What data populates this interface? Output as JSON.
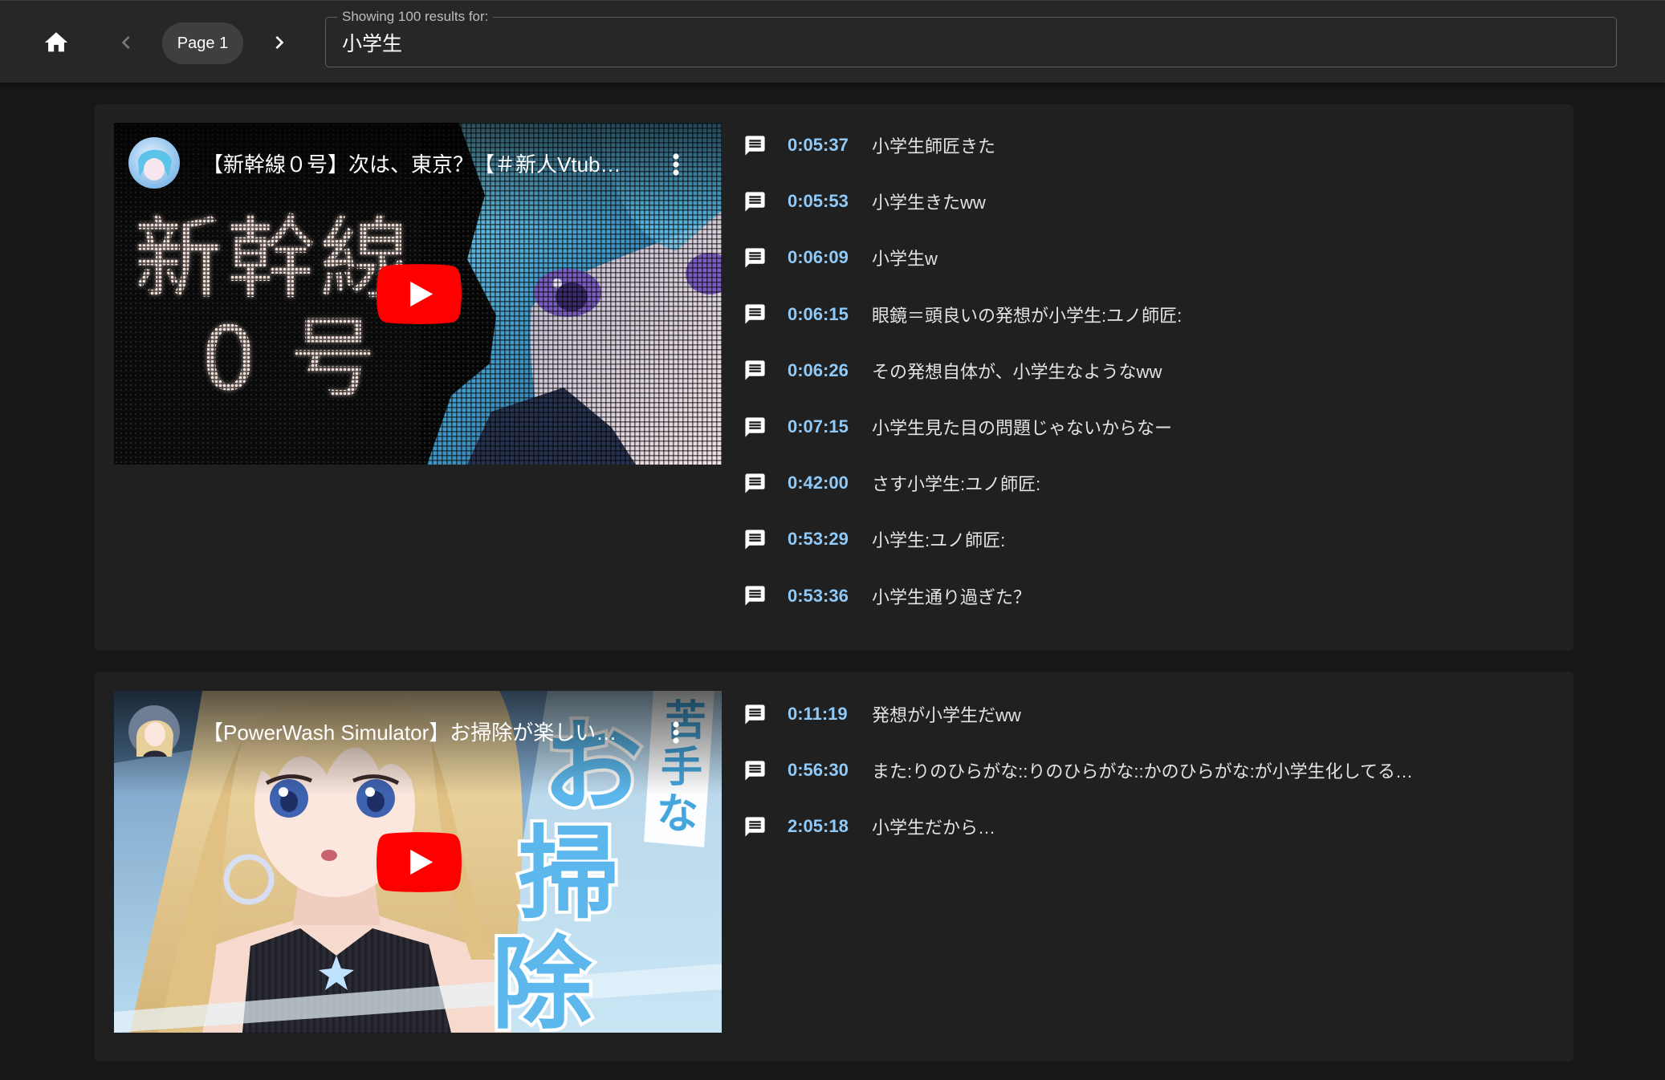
{
  "header": {
    "home_icon": "home-icon",
    "prev_page_icon": "chevron-left-icon",
    "next_page_icon": "chevron-right-icon",
    "page_label": "Page 1",
    "search": {
      "label": "Showing 100 results for:",
      "value": "小学生"
    }
  },
  "colors": {
    "page_background": "#171717",
    "header_background": "#272727",
    "card_background": "#202020",
    "timestamp": "#90caf9",
    "comment_text": "#e3e3e3",
    "play_button": "#ff0000"
  },
  "results": [
    {
      "video": {
        "title": "【新幹線０号】次は、東京？【＃新人Vtub…",
        "thumbnail_text": [
          "新幹線",
          "0号"
        ],
        "play_icon": "youtube-play-icon",
        "menu_icon": "more-vert-icon"
      },
      "comment_icon": "comment-icon",
      "comments": [
        {
          "time": "0:05:37",
          "text": "小学生師匠きた"
        },
        {
          "time": "0:05:53",
          "text": "小学生きたww"
        },
        {
          "time": "0:06:09",
          "text": "小学生w"
        },
        {
          "time": "0:06:15",
          "text": "眼鏡＝頭良いの発想が小学生:ユノ師匠:"
        },
        {
          "time": "0:06:26",
          "text": "その発想自体が、小学生なようなww"
        },
        {
          "time": "0:07:15",
          "text": "小学生見た目の問題じゃないからなー"
        },
        {
          "time": "0:42:00",
          "text": "さす小学生:ユノ師匠:"
        },
        {
          "time": "0:53:29",
          "text": "小学生:ユノ師匠:"
        },
        {
          "time": "0:53:36",
          "text": "小学生通り過ぎた？"
        }
      ]
    },
    {
      "video": {
        "title": "【PowerWash Simulator】お掃除が楽しい…",
        "thumbnail_text": [
          "苦手な",
          "お掃除"
        ],
        "play_icon": "youtube-play-icon",
        "menu_icon": "more-vert-icon"
      },
      "comment_icon": "comment-icon",
      "comments": [
        {
          "time": "0:11:19",
          "text": "発想が小学生だww"
        },
        {
          "time": "0:56:30",
          "text": "また:りのひらがな::りのひらがな::かのひらがな:が小学生化してる…"
        },
        {
          "time": "2:05:18",
          "text": "小学生だから…"
        }
      ]
    }
  ]
}
